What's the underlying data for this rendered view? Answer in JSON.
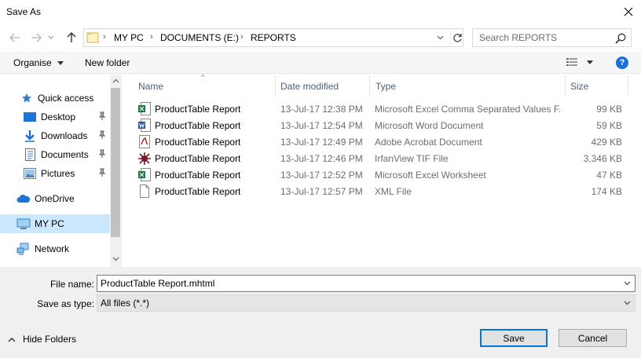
{
  "window": {
    "title": "Save As"
  },
  "address": {
    "crumbs": [
      "MY PC",
      "DOCUMENTS (E:)",
      "REPORTS"
    ]
  },
  "search": {
    "placeholder": "Search REPORTS"
  },
  "toolbar": {
    "organise_label": "Organise",
    "new_folder_label": "New folder"
  },
  "nav": {
    "quick_access": "Quick access",
    "items": [
      {
        "label": "Desktop",
        "icon": "desktop-icon",
        "pinned": true
      },
      {
        "label": "Downloads",
        "icon": "downloads-icon",
        "pinned": true
      },
      {
        "label": "Documents",
        "icon": "documents-icon",
        "pinned": true
      },
      {
        "label": "Pictures",
        "icon": "pictures-icon",
        "pinned": true
      }
    ],
    "onedrive": "OneDrive",
    "mypc": "MY PC",
    "network": "Network"
  },
  "columns": {
    "name": "Name",
    "date": "Date modified",
    "type": "Type",
    "size": "Size"
  },
  "files": [
    {
      "name": "ProductTable Report",
      "date": "13-Jul-17 12:38 PM",
      "type": "Microsoft Excel Comma Separated Values F...",
      "size": "99 KB",
      "icon": "csv-file-icon"
    },
    {
      "name": "ProductTable Report",
      "date": "13-Jul-17 12:54 PM",
      "type": "Microsoft Word Document",
      "size": "59 KB",
      "icon": "word-file-icon"
    },
    {
      "name": "ProductTable Report",
      "date": "13-Jul-17 12:49 PM",
      "type": "Adobe Acrobat Document",
      "size": "429 KB",
      "icon": "pdf-file-icon"
    },
    {
      "name": "ProductTable Report",
      "date": "13-Jul-17 12:46 PM",
      "type": "IrfanView TIF File",
      "size": "3,346 KB",
      "icon": "tif-file-icon"
    },
    {
      "name": "ProductTable Report",
      "date": "13-Jul-17 12:52 PM",
      "type": "Microsoft Excel Worksheet",
      "size": "47 KB",
      "icon": "excel-file-icon"
    },
    {
      "name": "ProductTable Report",
      "date": "13-Jul-17 12:57 PM",
      "type": "XML File",
      "size": "174 KB",
      "icon": "xml-file-icon"
    }
  ],
  "form": {
    "filename_label": "File name:",
    "filename_value": "ProductTable Report.mhtml",
    "savetype_label": "Save as type:",
    "savetype_value": "All files (*.*)"
  },
  "buttons": {
    "save": "Save",
    "cancel": "Cancel",
    "hide_folders": "Hide Folders"
  },
  "colors": {
    "accent": "#0078d7",
    "selected": "#cce8ff",
    "header_text": "#4c607a"
  }
}
